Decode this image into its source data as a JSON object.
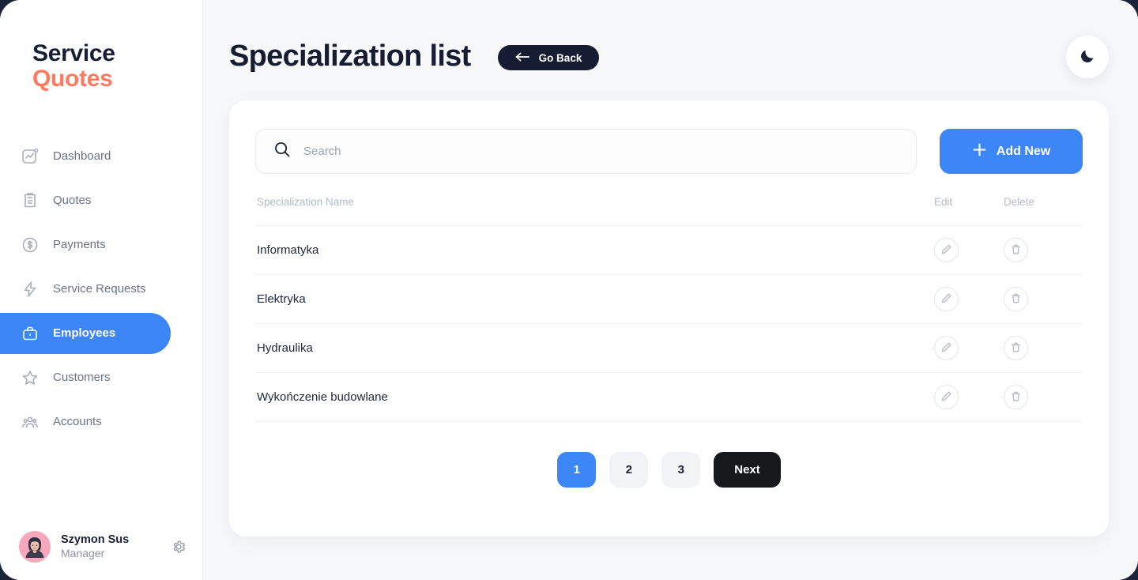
{
  "brand": {
    "line1": "Service",
    "line2": "Quotes",
    "accent_color": "#fd7a5e",
    "dark_color": "#171d33"
  },
  "sidebar": {
    "items": [
      {
        "label": "Dashboard",
        "icon": "dashboard-chart-icon",
        "active": false
      },
      {
        "label": "Quotes",
        "icon": "clipboard-icon",
        "active": false
      },
      {
        "label": "Payments",
        "icon": "dollar-circle-icon",
        "active": false
      },
      {
        "label": "Service Requests",
        "icon": "lightning-bolt-icon",
        "active": false
      },
      {
        "label": "Employees",
        "icon": "briefcase-icon",
        "active": true
      },
      {
        "label": "Customers",
        "icon": "star-icon",
        "active": false
      },
      {
        "label": "Accounts",
        "icon": "users-group-icon",
        "active": false
      }
    ],
    "user": {
      "name": "Szymon Sus",
      "role": "Manager",
      "settings_icon": "gear-icon"
    }
  },
  "header": {
    "title": "Specialization list",
    "go_back_label": "Go Back",
    "theme_toggle_icon": "moon-icon"
  },
  "toolbar": {
    "search_placeholder": "Search",
    "search_value": "",
    "search_icon": "search-icon",
    "add_new_label": "Add New",
    "add_new_icon": "plus-icon",
    "accent_color": "#3d86f7"
  },
  "table": {
    "columns": [
      "Specialization Name",
      "Edit",
      "Delete"
    ],
    "rows": [
      {
        "name": "Informatyka"
      },
      {
        "name": "Elektryka"
      },
      {
        "name": "Hydraulika"
      },
      {
        "name": "Wykończenie budowlane"
      }
    ],
    "edit_icon": "pencil-icon",
    "delete_icon": "trash-icon"
  },
  "pagination": {
    "pages": [
      "1",
      "2",
      "3"
    ],
    "active_page": "1",
    "next_label": "Next"
  }
}
